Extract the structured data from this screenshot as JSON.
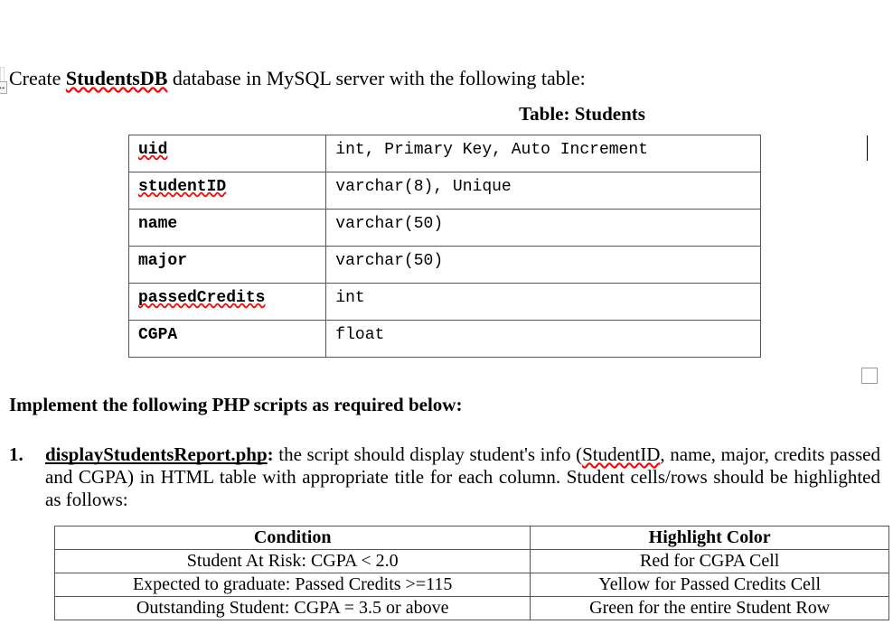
{
  "intro": {
    "prefix": "Create ",
    "dbname": "StudentsDB",
    "suffix": " database in MySQL server with the following table:"
  },
  "tableCaption": "Table: Students",
  "schema": [
    {
      "field": "uid",
      "spec": "int, Primary Key, Auto Increment",
      "wavy": true
    },
    {
      "field": "studentID",
      "spec": "varchar(8), Unique",
      "wavy": true
    },
    {
      "field": "name",
      "spec": "varchar(50)",
      "wavy": false
    },
    {
      "field": "major",
      "spec": "varchar(50)",
      "wavy": false
    },
    {
      "field": "passedCredits",
      "spec": "int",
      "wavy": true
    },
    {
      "field": "CGPA",
      "spec": "float",
      "wavy": false
    }
  ],
  "sectionHeading": "Implement the following PHP scripts as required below:",
  "item1": {
    "number": "1.",
    "scriptName": "displayStudentsReport.php",
    "colon": ":",
    "bodyPrefix": " the script should display student's info (",
    "studentIDword": "StudentID",
    "bodyRest": ", name, major, credits passed and CGPA) in HTML table with appropriate title for each column. Student cells/rows should be highlighted as follows:"
  },
  "condHeaders": {
    "c1": "Condition",
    "c2": "Highlight Color"
  },
  "condRows": [
    {
      "c1": "Student At Risk: CGPA < 2.0",
      "c2": "Red for CGPA Cell"
    },
    {
      "c1": "Expected to graduate: Passed Credits >=115",
      "c2": "Yellow for Passed Credits Cell"
    },
    {
      "c1": "Outstanding Student: CGPA = 3.5 or above",
      "c2": "Green for the entire Student Row"
    }
  ]
}
